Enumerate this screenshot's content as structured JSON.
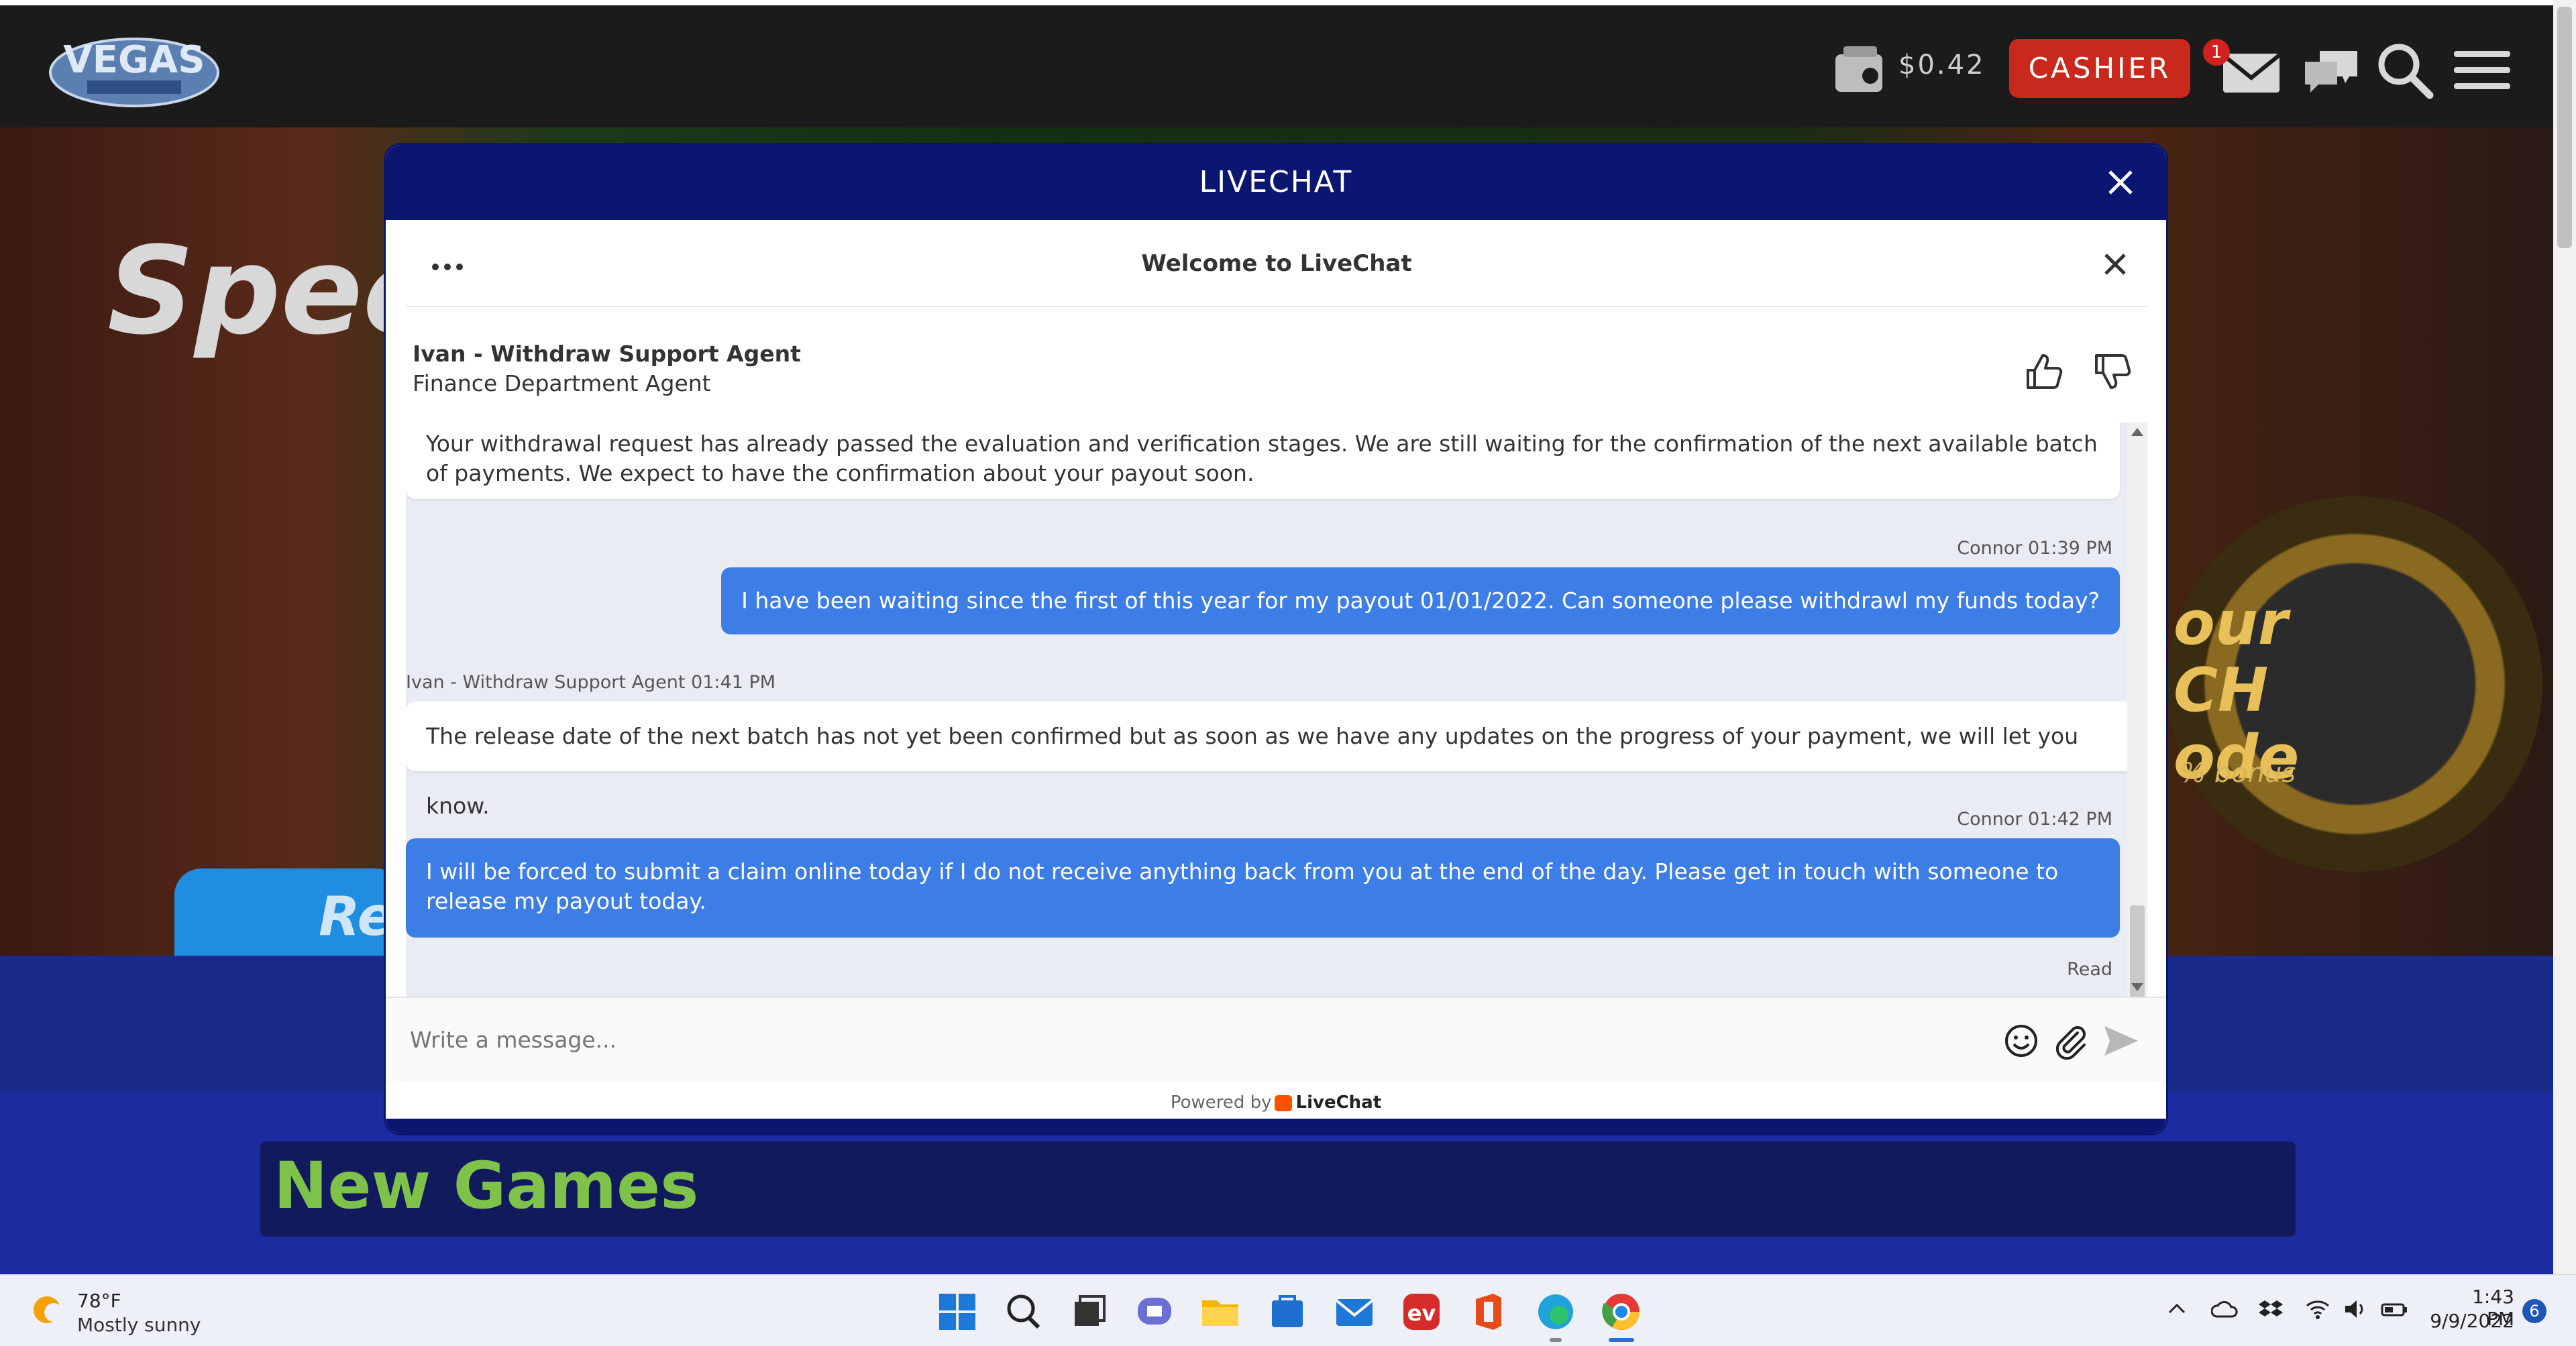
{
  "site": {
    "balance": "$0.42",
    "cashier_label": "CASHIER",
    "mail_badge": "1",
    "hero_text": "Speci",
    "hero_button_text": "Re",
    "badge_text": "our\nCH\node",
    "badge_bonus": "% bonus",
    "new_games": "New Games"
  },
  "modal": {
    "title": "LIVECHAT"
  },
  "chat": {
    "welcome": "Welcome to LiveChat",
    "agent_name": "Ivan - Withdraw Support Agent",
    "agent_role": "Finance Department Agent",
    "messages": [
      {
        "type": "agent",
        "text": "Your withdrawal request has already passed the evaluation and verification stages. We are still waiting for the confirmation of the next available batch of payments. We expect to have the confirmation about your payout soon."
      },
      {
        "type": "user",
        "meta": "Connor 01:39 PM",
        "text": "I have been waiting since the first of this year for my payout 01/01/2022. Can someone please withdrawl my funds today?"
      },
      {
        "type": "agent",
        "meta": "Ivan - Withdraw Support Agent 01:41 PM",
        "text": "The release date of the next batch has not yet been confirmed but as soon as we have any updates on the progress of your payment, we will let you know."
      },
      {
        "type": "user",
        "meta": "Connor 01:42 PM",
        "text": "I will be forced to submit a claim online today if I do not receive anything back from you at the end of the day. Please get in touch with someone to release my payout today."
      }
    ],
    "read_status": "Read",
    "composer_placeholder": "Write a message...",
    "powered_by": "Powered by",
    "powered_brand": "LiveChat"
  },
  "taskbar": {
    "weather_temp": "78°F",
    "weather_desc": "Mostly sunny",
    "time": "1:43 PM",
    "date": "9/9/2022",
    "notifications": "6"
  },
  "colors": {
    "modal_header": "#0b1670",
    "user_bubble": "#3d7de6",
    "cashier": "#c9281c",
    "new_games": "#7ec24a"
  }
}
